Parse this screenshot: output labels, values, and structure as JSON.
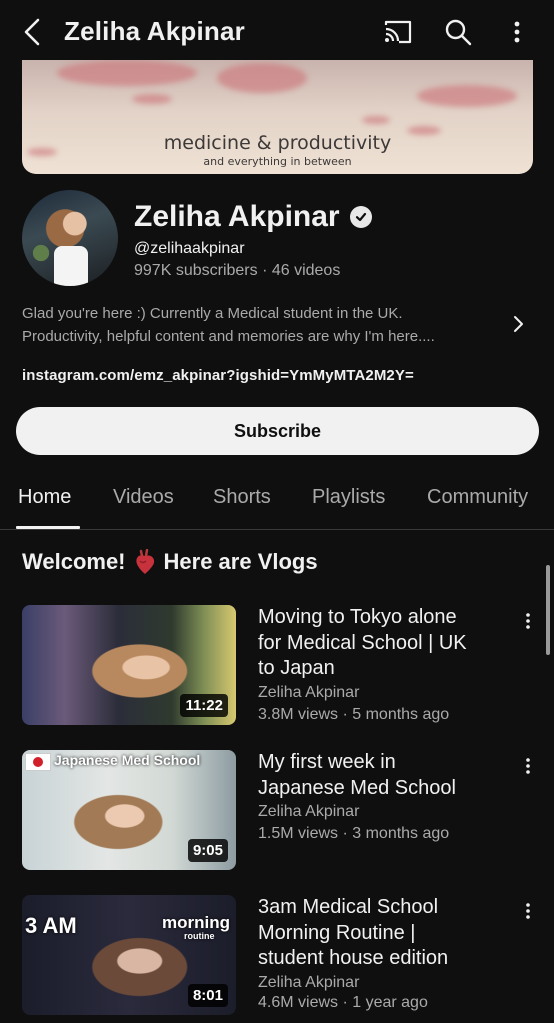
{
  "header": {
    "title": "Zeliha Akpinar",
    "icons": [
      "back-arrow-icon",
      "cast-icon",
      "search-icon",
      "more-vert-icon"
    ]
  },
  "banner": {
    "title": "medicine & productivity",
    "subtitle": "and everything in between"
  },
  "channel": {
    "name": "Zeliha Akpinar",
    "handle": "@zelihaakpinar",
    "stats": "997K subscribers · 46 videos",
    "description_line1": "Glad you're here :) Currently a Medical student in the UK.",
    "description_line2": "Productivity, helpful content and memories are why I'm here....",
    "link": "instagram.com/emz_akpinar?igshid=YmMyMTA2M2Y=",
    "subscribe_label": "Subscribe"
  },
  "tabs": [
    {
      "label": "Home",
      "active": true
    },
    {
      "label": "Videos",
      "active": false
    },
    {
      "label": "Shorts",
      "active": false
    },
    {
      "label": "Playlists",
      "active": false
    },
    {
      "label": "Community",
      "active": false
    }
  ],
  "section": {
    "title_pre": "Welcome!",
    "title_emoji": "❤",
    "title_post": "Here are Vlogs"
  },
  "videos": [
    {
      "title_lines": [
        "Moving to Tokyo alone",
        "for Medical School | UK",
        "to Japan"
      ],
      "channel": "Zeliha Akpinar",
      "meta": "3.8M views · 5 months ago",
      "duration": "11:22",
      "thumb_text": ""
    },
    {
      "title_lines": [
        "My first week in",
        "Japanese Med School"
      ],
      "channel": "Zeliha Akpinar",
      "meta": "1.5M views · 3 months ago",
      "duration": "9:05",
      "thumb_text": "Japanese Med School"
    },
    {
      "title_lines": [
        "3am Medical School",
        "Morning Routine |",
        "student house edition"
      ],
      "channel": "Zeliha Akpinar",
      "meta": "4.6M views · 1 year ago",
      "duration": "8:01",
      "thumb_text": "3 AM",
      "thumb_text2": "morning",
      "thumb_text3": "routine"
    }
  ],
  "colors": {
    "background": "#0f0f0f",
    "text": "#f1f1f1",
    "secondary_text": "#aaaaaa",
    "subscribe_bg": "#f1f1f1"
  }
}
